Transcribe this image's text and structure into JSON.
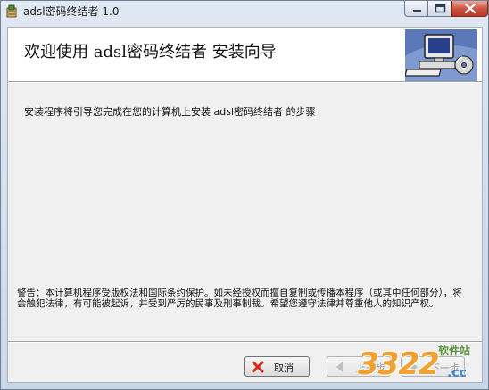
{
  "window": {
    "title": "adsl密码终结者 1.0"
  },
  "header": {
    "title": "欢迎使用 adsl密码终结者 安装向导",
    "logo_icon": "computer-disk-icon"
  },
  "content": {
    "intro": "安装程序将引导您完成在您的计算机上安装 adsl密码终结者 的步骤",
    "warning": "警告：本计算机程序受版权法和国际条约保护。如未经授权而擅自复制或传播本程序（或其中任何部分），将会触犯法律，有可能被起诉，并受到严厉的民事及刑事制裁。希望您遵守法律并尊重他人的知识产权。"
  },
  "buttons": {
    "cancel_label": "取消",
    "back_label": "上一步",
    "next_label": "下一步"
  },
  "watermark": {
    "number": "3322",
    "suffix": ".cc",
    "site": "软件站"
  },
  "colors": {
    "cancel_x": "#d42a1c",
    "watermark_orange": "#f29a1d",
    "watermark_blue": "#2f7fd3"
  }
}
